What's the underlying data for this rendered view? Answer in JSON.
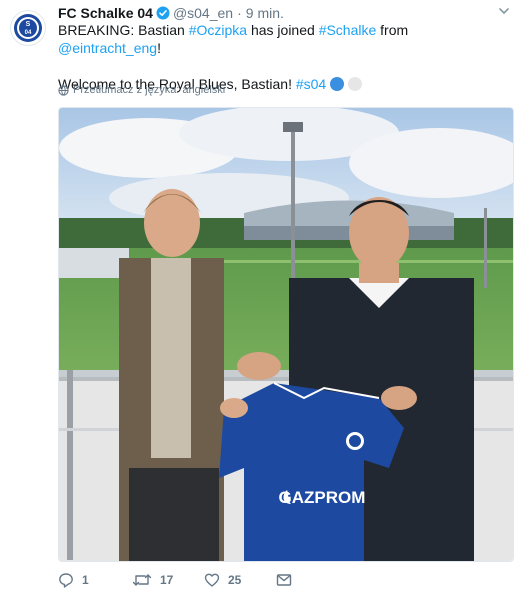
{
  "account": {
    "name": "FC Schalke 04",
    "handle": "@s04_en",
    "separator": "·",
    "time": "9 min."
  },
  "tweet": {
    "line1": {
      "prefix": "BREAKING: Bastian ",
      "hashtag1": "#Oczipka",
      "mid1": " has joined ",
      "hashtag2": "#Schalke",
      "mid2": " from ",
      "mention": "@eintracht_eng",
      "suffix": "!"
    },
    "line2": {
      "prefix": "Welcome to the Royal Blues, Bastian! ",
      "hashtag": "#s04"
    }
  },
  "translate_label": "Przetłumacz z języka: angielski",
  "media": {
    "jersey_sponsor": "GAZPROM",
    "badge_text": "04"
  },
  "actions": {
    "replies": "1",
    "retweets": "17",
    "likes": "25"
  },
  "colors": {
    "link": "#1da1f2",
    "schalke_blue": "#1d4aa0",
    "muted": "#657786"
  }
}
